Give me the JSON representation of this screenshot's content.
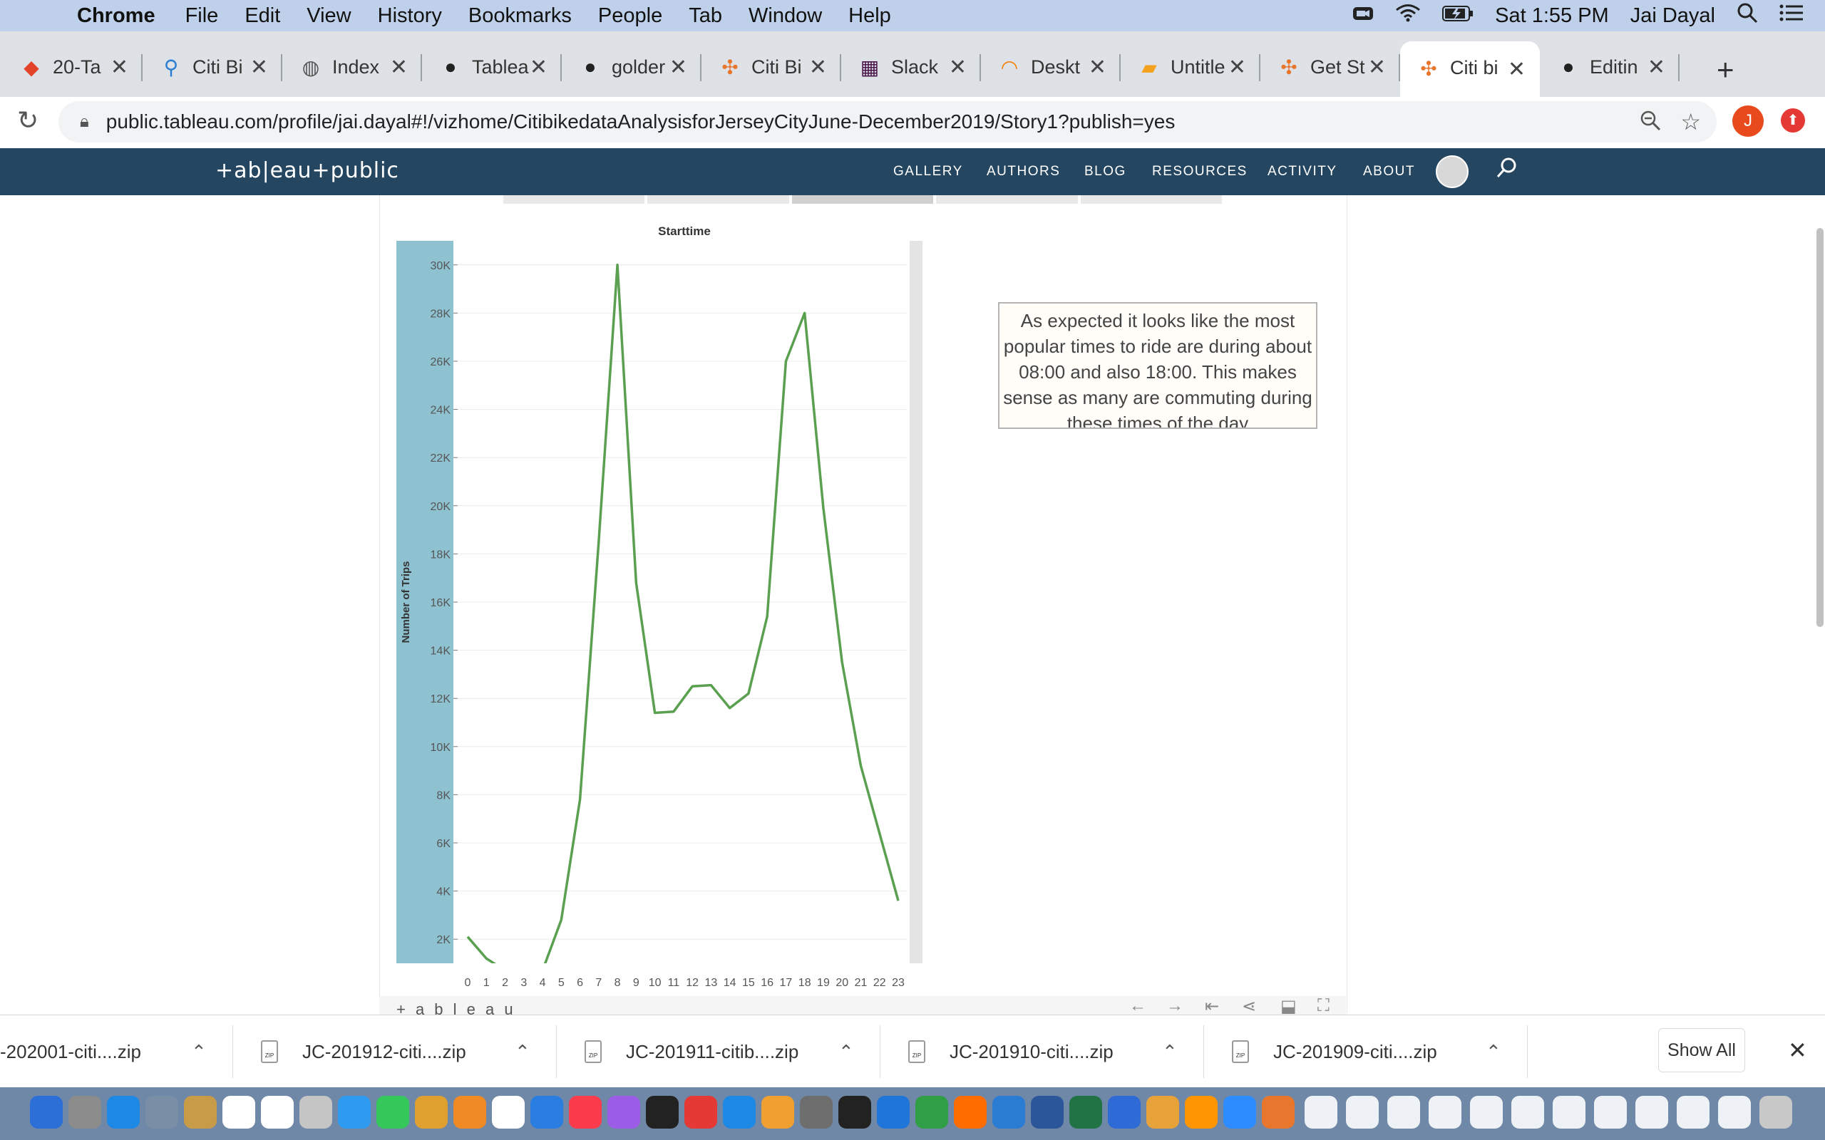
{
  "menubar": {
    "app": "Chrome",
    "items": [
      "File",
      "Edit",
      "View",
      "History",
      "Bookmarks",
      "People",
      "Tab",
      "Window",
      "Help"
    ],
    "clock": "Sat 1:55 PM",
    "user": "Jai Dayal"
  },
  "tabs": [
    {
      "title": "20-Ta",
      "icon": "gitlab-icon",
      "color": "#e24329"
    },
    {
      "title": "Citi Bi",
      "icon": "bike-icon",
      "color": "#2a7ed2"
    },
    {
      "title": "Index",
      "icon": "globe-icon",
      "color": "#555555"
    },
    {
      "title": "Tablea",
      "icon": "github-icon",
      "color": "#222222"
    },
    {
      "title": "golder",
      "icon": "github-icon",
      "color": "#222222"
    },
    {
      "title": "Citi Bi",
      "icon": "tableau-icon",
      "color": "#e8762d"
    },
    {
      "title": "Slack",
      "icon": "slack-icon",
      "color": "#4a154b"
    },
    {
      "title": "Deskt",
      "icon": "spinner-icon",
      "color": "#f57c00"
    },
    {
      "title": "Untitle",
      "icon": "book-icon",
      "color": "#f4a11d"
    },
    {
      "title": "Get St",
      "icon": "tableau-icon",
      "color": "#e8762d"
    },
    {
      "title": "Citi bi",
      "icon": "tableau-icon",
      "color": "#e8762d",
      "active": true
    },
    {
      "title": "Editin",
      "icon": "github-icon",
      "color": "#222222"
    }
  ],
  "address_bar": {
    "url": "public.tableau.com/profile/jai.dayal#!/vizhome/CitibikedataAnalysisforJerseyCityJune-December2019/Story1?publish=yes",
    "profile_initial": "J"
  },
  "tableau_header": {
    "logo": "+ab|eau+public",
    "nav": [
      "GALLERY",
      "AUTHORS",
      "BLOG",
      "RESOURCES",
      "ACTIVITY",
      "ABOUT"
    ]
  },
  "chart_data": {
    "type": "line",
    "title": "Starttime",
    "xlabel": "",
    "ylabel": "Number of Trips",
    "x": [
      0,
      1,
      2,
      3,
      4,
      5,
      6,
      7,
      8,
      9,
      10,
      11,
      12,
      13,
      14,
      15,
      16,
      17,
      18,
      19,
      20,
      21,
      22,
      23
    ],
    "series": [
      {
        "values": [
          2100,
          1200,
          700,
          200,
          700,
          2800,
          7800,
          18500,
          30000,
          16800,
          11400,
          11450,
          12500,
          12550,
          11600,
          12200,
          15400,
          26000,
          28000,
          19900,
          13500,
          9200,
          6400,
          3600
        ],
        "color": "#5aa050"
      }
    ],
    "ylim": [
      1000,
      31000
    ],
    "yticks": [
      2000,
      4000,
      6000,
      8000,
      10000,
      12000,
      14000,
      16000,
      18000,
      20000,
      22000,
      24000,
      26000,
      28000,
      30000
    ],
    "ytick_labels": [
      "2K",
      "4K",
      "6K",
      "8K",
      "10K",
      "12K",
      "14K",
      "16K",
      "18K",
      "20K",
      "22K",
      "24K",
      "26K",
      "28K",
      "30K"
    ],
    "grid": true,
    "axis_band_color": "#8fc2d1"
  },
  "caption": "As expected it looks like the most popular times to ride are during about 08:00 and also 18:00. This makes sense as many are commuting during these times of the day",
  "viz_footer": {
    "brand": "+ a b l e a u"
  },
  "downloads": [
    {
      "name": "-202001-citi....zip"
    },
    {
      "name": "JC-201912-citi....zip"
    },
    {
      "name": "JC-201911-citib....zip"
    },
    {
      "name": "JC-201910-citi....zip"
    },
    {
      "name": "JC-201909-citi....zip"
    }
  ],
  "show_all": "Show All"
}
